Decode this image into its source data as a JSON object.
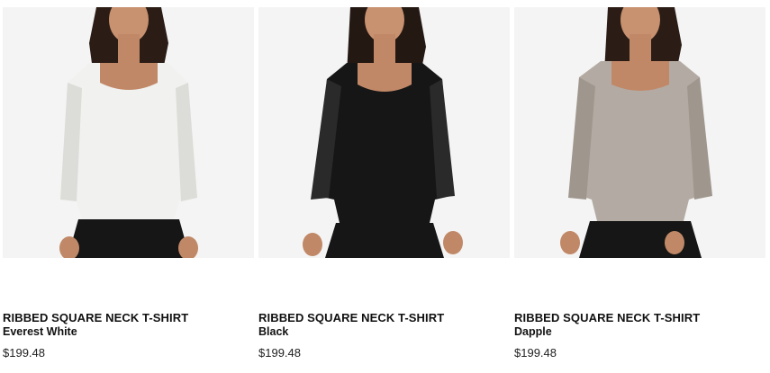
{
  "products": [
    {
      "name": "RIBBED SQUARE NECK T-SHIRT",
      "color": "Everest White",
      "price": "$199.48",
      "shirt_color": "#f1f1ef",
      "shirt_shade": "#dcdcd8",
      "image_icon": "model-photo-icon"
    },
    {
      "name": "RIBBED SQUARE NECK T-SHIRT",
      "color": "Black",
      "price": "$199.48",
      "shirt_color": "#161616",
      "shirt_shade": "#2a2a2a",
      "image_icon": "model-photo-icon"
    },
    {
      "name": "RIBBED SQUARE NECK T-SHIRT",
      "color": "Dapple",
      "price": "$199.48",
      "shirt_color": "#b3aba3",
      "shirt_shade": "#9f968d",
      "image_icon": "model-photo-icon"
    }
  ]
}
